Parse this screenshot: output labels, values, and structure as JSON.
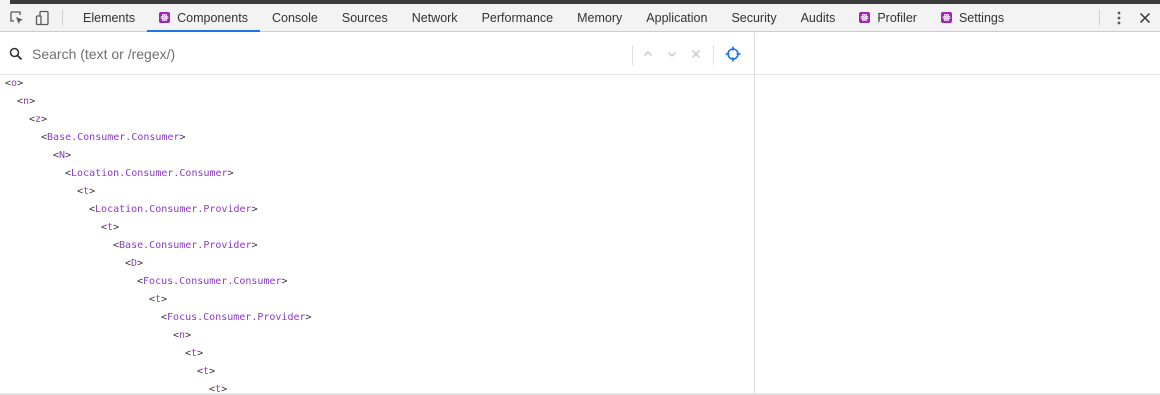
{
  "toolbar": {
    "tabs": [
      {
        "label": "Elements",
        "react": false
      },
      {
        "label": "Components",
        "react": true,
        "active": true
      },
      {
        "label": "Console",
        "react": false
      },
      {
        "label": "Sources",
        "react": false
      },
      {
        "label": "Network",
        "react": false
      },
      {
        "label": "Performance",
        "react": false
      },
      {
        "label": "Memory",
        "react": false
      },
      {
        "label": "Application",
        "react": false
      },
      {
        "label": "Security",
        "react": false
      },
      {
        "label": "Audits",
        "react": false
      },
      {
        "label": "Profiler",
        "react": true
      },
      {
        "label": "Settings",
        "react": true
      }
    ],
    "icons": {
      "inspect": "inspect-element-icon",
      "device": "device-toolbar-icon",
      "more": "more-vertical-icon",
      "close": "close-icon"
    }
  },
  "search": {
    "placeholder": "Search (text or /regex/)",
    "value": ""
  },
  "tree": {
    "rows": [
      {
        "name": "o",
        "depth": 0
      },
      {
        "name": "n",
        "depth": 1
      },
      {
        "name": "z",
        "depth": 2
      },
      {
        "name": "Base.Consumer.Consumer",
        "depth": 3
      },
      {
        "name": "N",
        "depth": 4
      },
      {
        "name": "Location.Consumer.Consumer",
        "depth": 5
      },
      {
        "name": "t",
        "depth": 6
      },
      {
        "name": "Location.Consumer.Provider",
        "depth": 7
      },
      {
        "name": "t",
        "depth": 8
      },
      {
        "name": "Base.Consumer.Provider",
        "depth": 9
      },
      {
        "name": "D",
        "depth": 10
      },
      {
        "name": "Focus.Consumer.Consumer",
        "depth": 11
      },
      {
        "name": "t",
        "depth": 12
      },
      {
        "name": "Focus.Consumer.Provider",
        "depth": 13
      },
      {
        "name": "n",
        "depth": 14
      },
      {
        "name": "t",
        "depth": 15
      },
      {
        "name": "t",
        "depth": 16
      },
      {
        "name": "t",
        "depth": 17
      }
    ]
  },
  "colors": {
    "accent": "#1a73e8",
    "component_name": "#8d3cc0",
    "react_badge": "#9c27b0"
  }
}
